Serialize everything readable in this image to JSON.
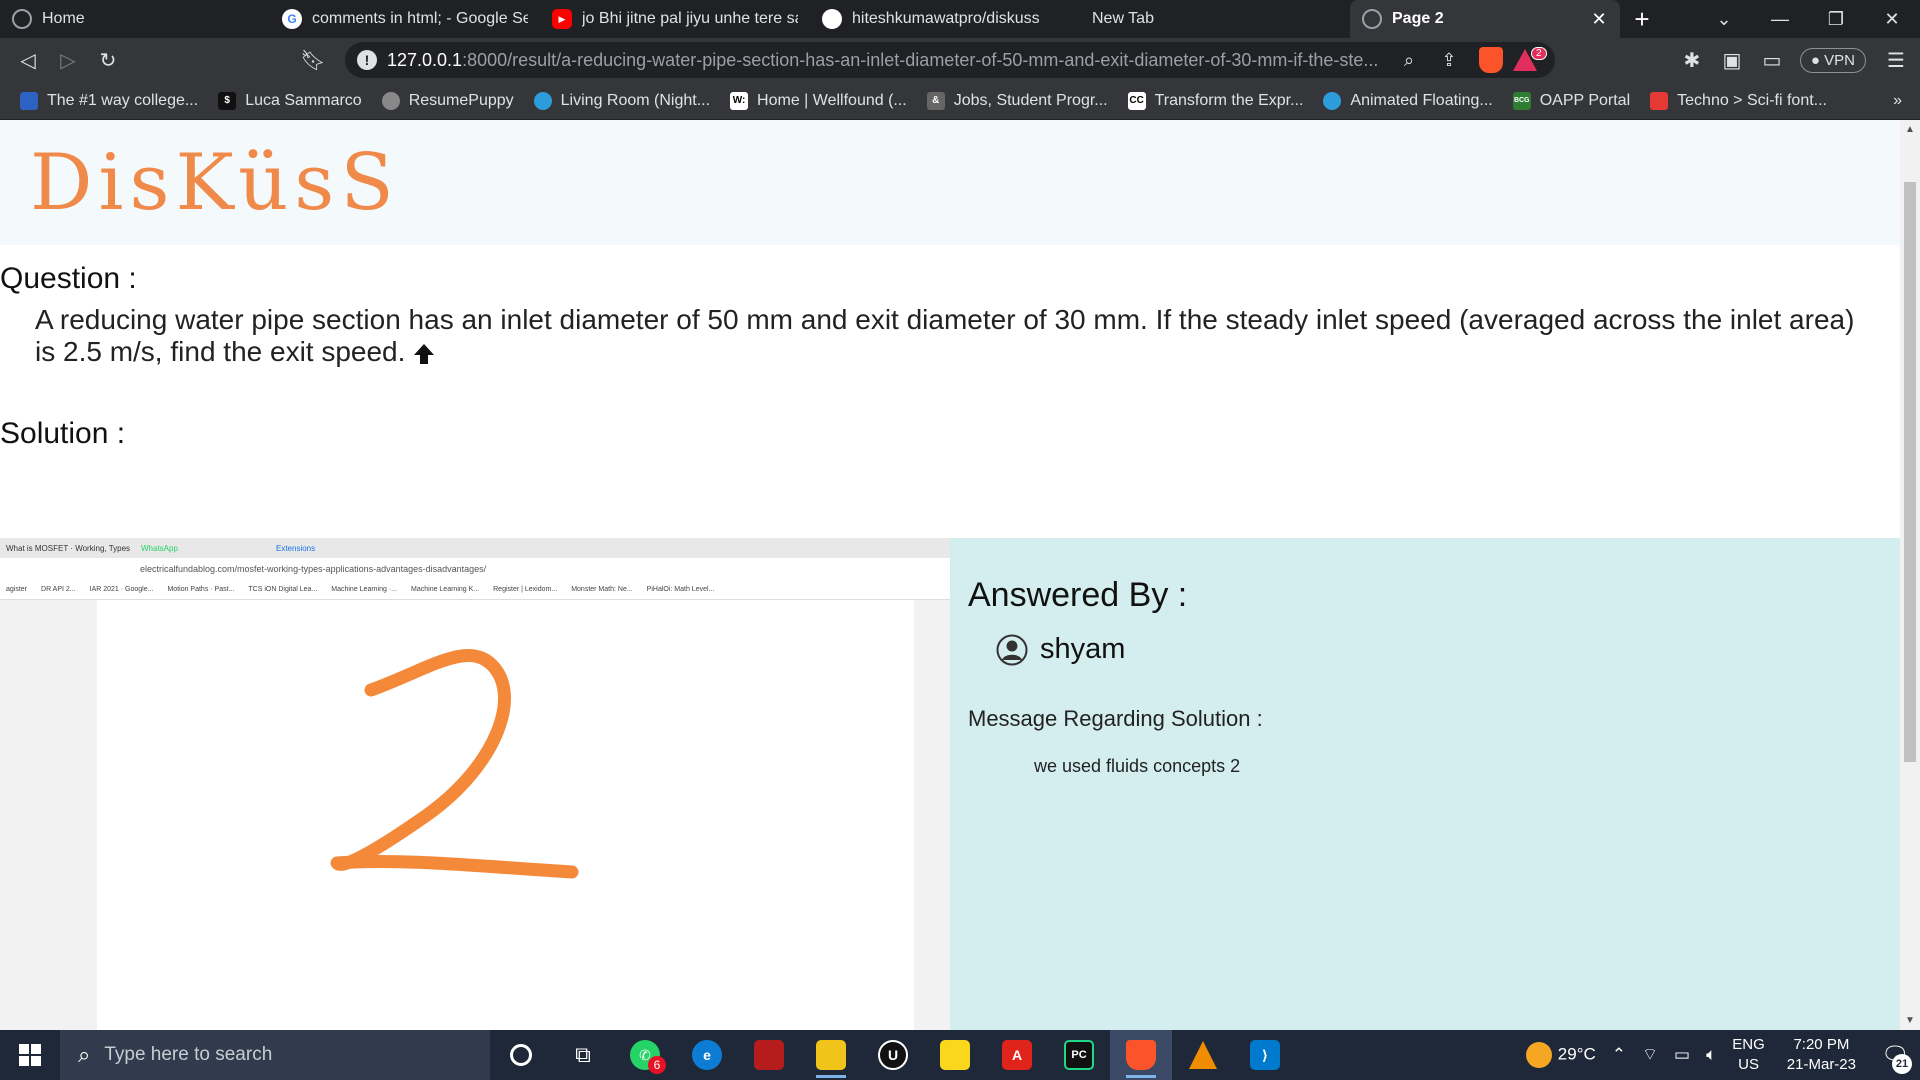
{
  "browser": {
    "tabs": [
      {
        "title": "Home",
        "icon": "globe-icon",
        "icon_color": "#9aa0a6"
      },
      {
        "title": "comments in html; - Google Sear",
        "icon": "google-icon",
        "icon_color": "#ffffff"
      },
      {
        "title": "jo Bhi jitne pal jiyu unhe tere san",
        "icon": "youtube-icon",
        "icon_color": "#ff0000"
      },
      {
        "title": "hiteshkumawatpro/diskuss",
        "icon": "github-icon",
        "icon_color": "#ffffff"
      },
      {
        "title": "New Tab",
        "icon": "",
        "icon_color": ""
      },
      {
        "title": "Page 2",
        "icon": "globe-icon",
        "icon_color": "#9aa0a6",
        "active": true
      }
    ],
    "url_host": "127.0.0.1",
    "url_path": ":8000/result/a-reducing-water-pipe-section-has-an-inlet-diameter-of-50-mm-and-exit-diameter-of-30-mm-if-the-ste...",
    "vpn_label": "VPN",
    "brave_badge": "2",
    "bookmarks": [
      {
        "label": "The #1 way college...",
        "icon_color": "#2b62c4"
      },
      {
        "label": "Luca Sammarco",
        "icon_color": "#111111"
      },
      {
        "label": "ResumePuppy",
        "icon_color": "#888888"
      },
      {
        "label": "Living Room (Night...",
        "icon_color": "#2d9cdb"
      },
      {
        "label": "Home | Wellfound (...",
        "icon_color": "#ffffff"
      },
      {
        "label": "Jobs, Student Progr...",
        "icon_color": "#666666"
      },
      {
        "label": "Transform the Expr...",
        "icon_color": "#ffffff"
      },
      {
        "label": "Animated Floating...",
        "icon_color": "#2d9cdb"
      },
      {
        "label": "OAPP Portal",
        "icon_color": "#2e7d32"
      },
      {
        "label": "Techno > Sci-fi font...",
        "icon_color": "#e53935"
      }
    ],
    "bookmarks_more": "»"
  },
  "page": {
    "logo": "DisKüsS",
    "question_heading": "Question :",
    "question_text": "A reducing water pipe section has an inlet diameter of 50 mm and exit diameter of 30 mm. If the steady inlet speed (averaged across the inlet area) is 2.5 m/s, find the exit speed.",
    "solution_heading": "Solution :",
    "solution_image": {
      "mini_tabs": [
        "What is MOSFET · Working, Types",
        "WhatsApp",
        "Extensions"
      ],
      "mini_url": "electricalfundablog.com/mosfet-working-types-applications-advantages-disadvantages/",
      "mini_bookmarks": [
        "agister",
        "DR API 2...",
        "IAR 2021 · Google...",
        "Motion Paths · Past...",
        "TCS iON Digital Lea...",
        "Machine Learning ·...",
        "Machine Learning K...",
        "Register | Lexidom...",
        "Monster Math: Ne...",
        "PiHalOi: Math Level..."
      ],
      "handwritten_digit": "2",
      "stroke_color": "#f5893a"
    },
    "answered_by_heading": "Answered By :",
    "answerer_name": "shyam",
    "message_heading": "Message Regarding Solution :",
    "message_text": "we used fluids concepts 2"
  },
  "taskbar": {
    "search_placeholder": "Type here to search",
    "apps": [
      {
        "name": "cortana",
        "color": "#1f2838"
      },
      {
        "name": "task-view",
        "color": "#1f2838"
      },
      {
        "name": "whatsapp",
        "color": "#25d366",
        "badge": "6"
      },
      {
        "name": "edge",
        "color": "#0c7cd5"
      },
      {
        "name": "game-app",
        "color": "#b71c1c"
      },
      {
        "name": "file-explorer",
        "color": "#f0c419"
      },
      {
        "name": "unreal",
        "color": "#111111"
      },
      {
        "name": "sticky-notes",
        "color": "#f9d71c"
      },
      {
        "name": "acrobat",
        "color": "#e0241b"
      },
      {
        "name": "pycharm",
        "color": "#21d789"
      },
      {
        "name": "brave",
        "color": "#fb542b",
        "running": true
      },
      {
        "name": "vlc",
        "color": "#f08c00"
      },
      {
        "name": "vscode",
        "color": "#007acc"
      }
    ],
    "weather": "29°C",
    "lang_top": "ENG",
    "lang_bottom": "US",
    "time": "7:20 PM",
    "date": "21-Mar-23",
    "notification_count": "21"
  }
}
